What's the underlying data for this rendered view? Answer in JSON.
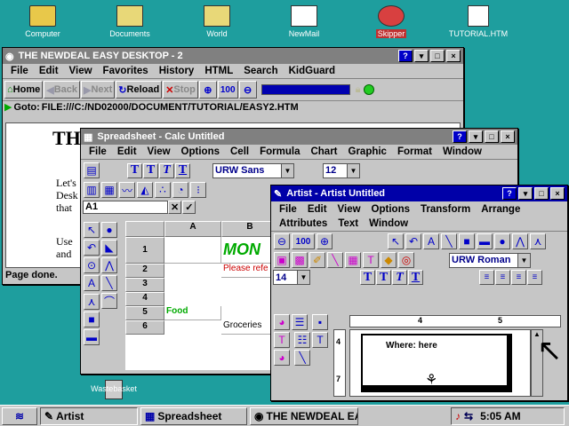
{
  "desktop": {
    "icons": [
      {
        "label": "Computer",
        "icon": "computer-icon",
        "color": "#e8c84a"
      },
      {
        "label": "Documents",
        "icon": "folder-icon",
        "color": "#e8d878"
      },
      {
        "label": "World",
        "icon": "folder-world-icon",
        "color": "#e8d878"
      },
      {
        "label": "NewMail",
        "icon": "mail-icon",
        "color": "#ffffff"
      },
      {
        "label": "Skipper",
        "icon": "skipper-icon",
        "color": "#d84040"
      },
      {
        "label": "TUTORIAL.HTM",
        "icon": "html-file-icon",
        "color": "#ffffff"
      }
    ],
    "wastebasket": "Wastebasket"
  },
  "browser": {
    "title": "THE NEWDEAL EASY DESKTOP - 2",
    "menu": [
      "File",
      "Edit",
      "View",
      "Favorites",
      "History",
      "HTML",
      "Search",
      "KidGuard"
    ],
    "toolbar": {
      "home": "Home",
      "back": "Back",
      "next": "Next",
      "reload": "Reload",
      "stop": "Stop",
      "zoom": "100"
    },
    "goto_label": "Goto:",
    "url": "FILE:///C:/ND02000/DOCUMENT/TUTORIAL/EASY2.HTM",
    "heading": "TH",
    "body_lines": [
      "Let's",
      "Desk",
      "that",
      "Use",
      "and"
    ],
    "status": "Page done."
  },
  "spreadsheet": {
    "title": "Spreadsheet - Calc Untitled",
    "menu": [
      "File",
      "Edit",
      "View",
      "Options",
      "Cell",
      "Formula",
      "Chart",
      "Graphic",
      "Format",
      "Window"
    ],
    "font": "URW Sans",
    "size": "12",
    "cell_ref": "A1",
    "columns": [
      "A",
      "B"
    ],
    "rows": [
      "1",
      "2",
      "3",
      "4",
      "5",
      "6"
    ],
    "cells": {
      "b1": "MON",
      "b2": "Please refe",
      "a5": "Food",
      "b6": "Groceries"
    }
  },
  "artist": {
    "title": "Artist - Artist Untitled",
    "menu": [
      "File",
      "Edit",
      "View",
      "Options",
      "Transform",
      "Arrange"
    ],
    "menu2": [
      "Attributes",
      "Text",
      "Window"
    ],
    "zoom": "100",
    "font": "URW Roman",
    "size": "14",
    "ruler": [
      "4",
      "5"
    ],
    "vruler": [
      "4",
      "7"
    ],
    "canvas_text": "Where: here"
  },
  "taskbar": {
    "items": [
      "Artist",
      "Spreadsheet",
      "THE NEWDEAL EAS"
    ],
    "clock": "5:05 AM"
  }
}
